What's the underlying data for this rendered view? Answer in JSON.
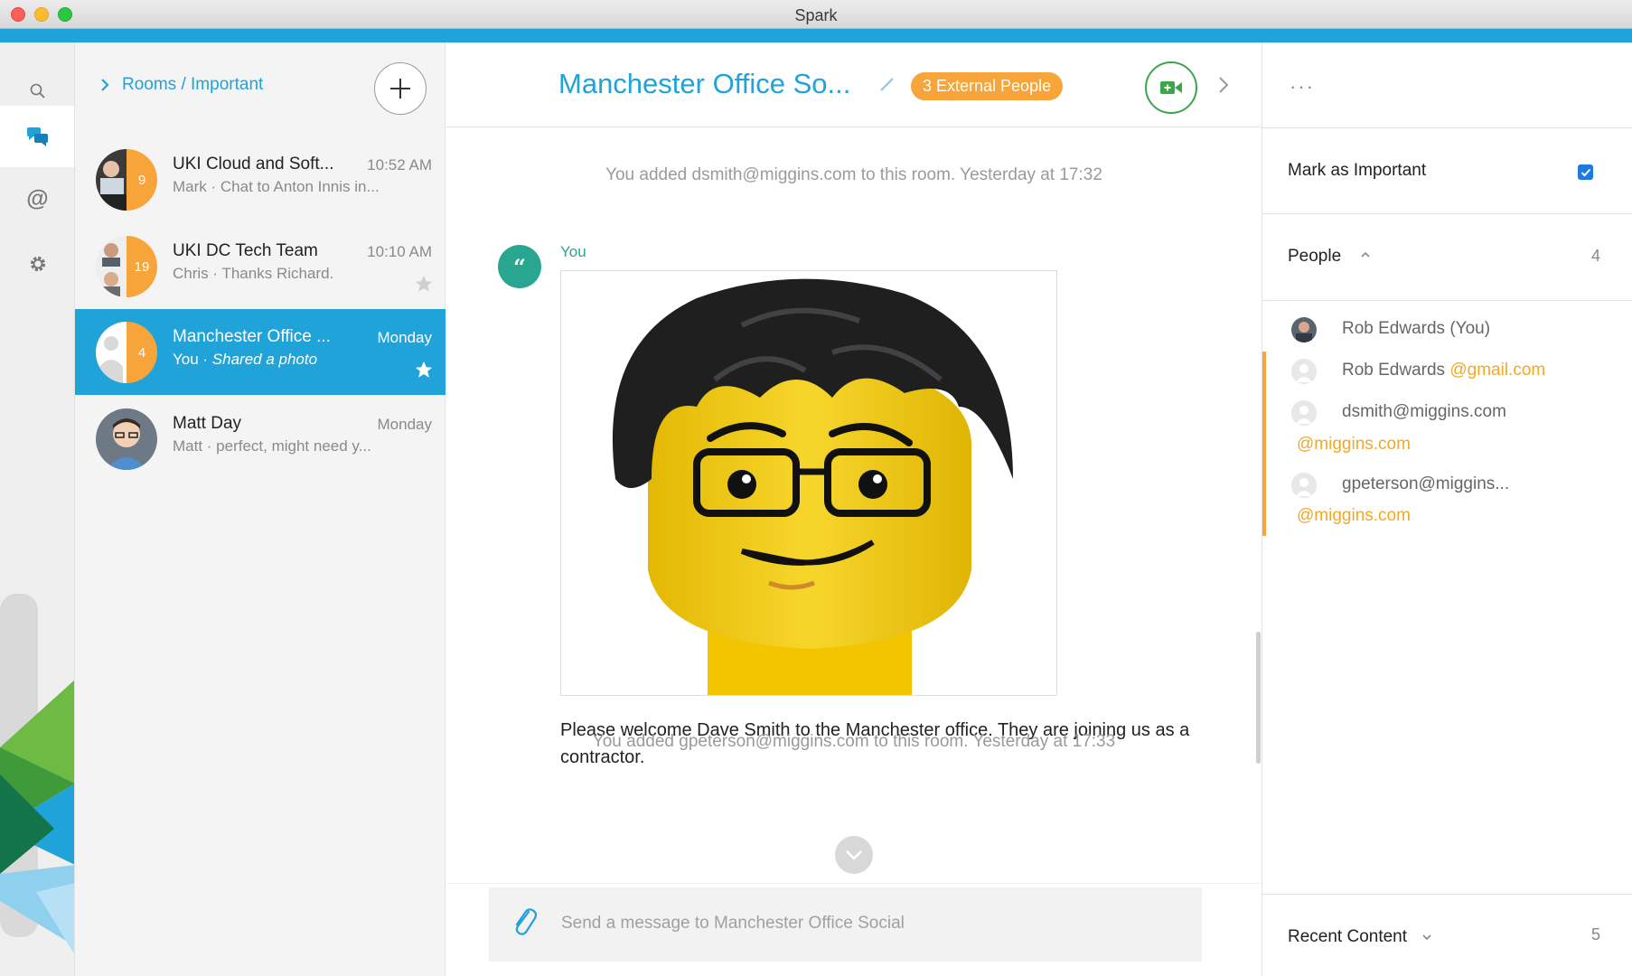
{
  "window": {
    "title": "Spark"
  },
  "rail": {
    "items": [
      {
        "icon": "search-icon"
      },
      {
        "icon": "chat-bubbles-icon",
        "active": true
      },
      {
        "icon": "mention-at-icon"
      },
      {
        "icon": "gear-icon"
      }
    ]
  },
  "rooms": {
    "breadcrumb": {
      "root": "Rooms",
      "sep": "/",
      "current": "Important"
    },
    "items": [
      {
        "name": "UKI Cloud and Soft...",
        "time": "10:52 AM",
        "preview": "Mark · Chat to Anton Innis in...",
        "badge": "9",
        "starred": false,
        "active": false
      },
      {
        "name": "UKI DC Tech Team",
        "time": "10:10 AM",
        "preview": "Chris · Thanks Richard.",
        "badge": "19",
        "starred": true,
        "active": false
      },
      {
        "name": "Manchester Office ...",
        "time": "Monday",
        "preview_sender": "You · ",
        "preview_italic": "Shared a photo",
        "badge": "4",
        "starred": true,
        "active": true
      },
      {
        "name": "Matt Day",
        "time": "Monday",
        "preview": "Matt · perfect, might need y...",
        "badge": "",
        "starred": false,
        "active": false
      }
    ]
  },
  "conversation": {
    "title": "Manchester Office So...",
    "external_badge": "3 External People",
    "system_messages": [
      "You added dsmith@miggins.com to this room.  Yesterday at 17:32",
      "You added gpeterson@miggins.com to this room.  Yesterday at 17:33"
    ],
    "message": {
      "avatar_glyph": "“",
      "sender": "You",
      "text": "Please welcome Dave Smith to the Manchester office. They are joining us as a contractor."
    },
    "composer_placeholder": "Send a message to Manchester Office Social"
  },
  "side": {
    "more": "···",
    "mark_important": {
      "label": "Mark as Important",
      "checked": true
    },
    "people": {
      "label": "People",
      "count": "4",
      "items": [
        {
          "name": "Rob Edwards (You)",
          "domain": ""
        },
        {
          "name": "Rob Edwards ",
          "domain": "@gmail.com"
        },
        {
          "name": "dsmith@miggins.com",
          "domain": "",
          "domain_line": "@miggins.com"
        },
        {
          "name": "gpeterson@miggins...",
          "domain": "",
          "domain_line": "@miggins.com"
        }
      ]
    },
    "recent_content": {
      "label": "Recent Content",
      "count": "5"
    }
  },
  "colors": {
    "accent": "#1fa3d8",
    "external": "#f7a43a",
    "teal": "#29a68f",
    "video": "#3ba54a"
  }
}
